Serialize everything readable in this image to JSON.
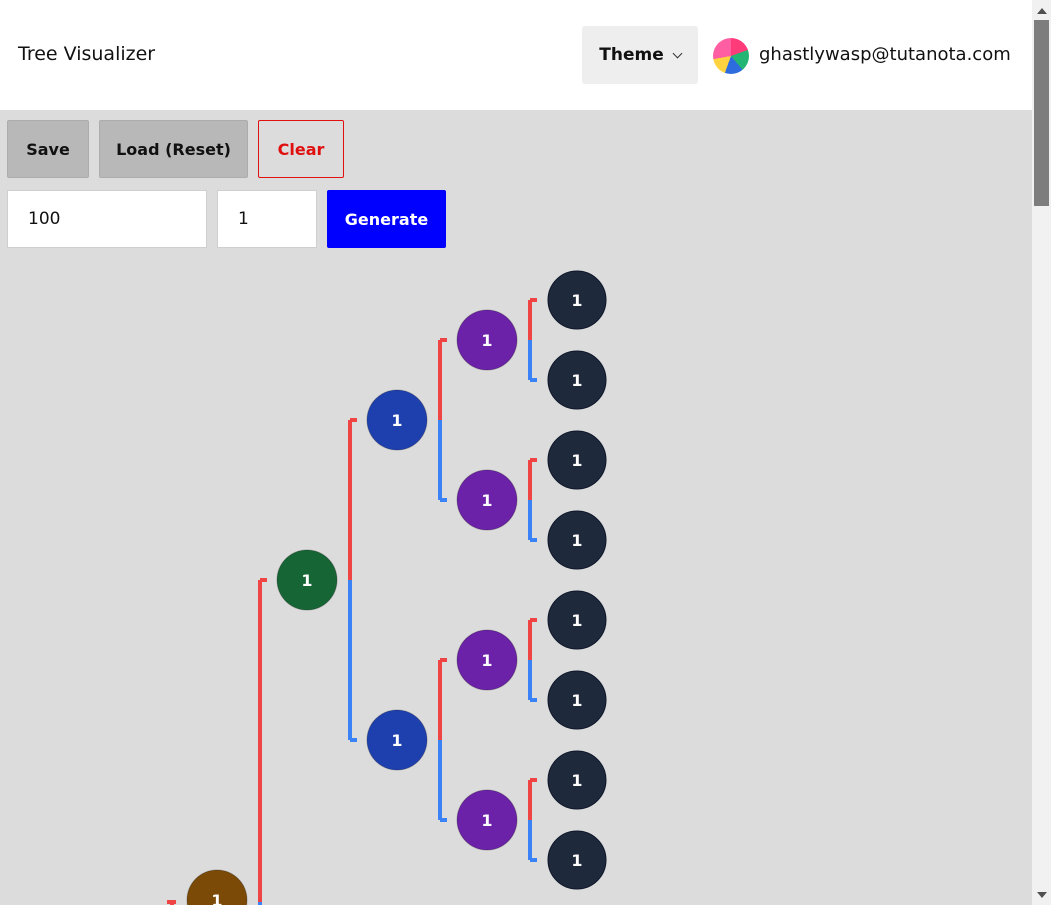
{
  "app": {
    "title": "Tree Visualizer"
  },
  "header": {
    "theme_label": "Theme",
    "user_email": "ghastlywasp@tutanota.com"
  },
  "toolbar": {
    "save_label": "Save",
    "load_label": "Load (Reset)",
    "clear_label": "Clear",
    "generate_label": "Generate"
  },
  "inputs": {
    "count_value": "100",
    "value_value": "1"
  },
  "tree": {
    "node_value": "1",
    "colors": {
      "level0": "#7a4a06",
      "level1": "#166534",
      "level2": "#1e40af",
      "level3": "#6b21a8",
      "level4": "#1e293b",
      "left_edge": "#ef4444",
      "right_edge": "#3b82f6"
    },
    "nodes": [
      {
        "id": "n0",
        "level": 0,
        "value": "1"
      },
      {
        "id": "n1",
        "level": 1,
        "value": "1"
      },
      {
        "id": "n2a",
        "level": 2,
        "value": "1"
      },
      {
        "id": "n2b",
        "level": 2,
        "value": "1"
      },
      {
        "id": "n3a",
        "level": 3,
        "value": "1"
      },
      {
        "id": "n3b",
        "level": 3,
        "value": "1"
      },
      {
        "id": "n3c",
        "level": 3,
        "value": "1"
      },
      {
        "id": "n3d",
        "level": 3,
        "value": "1"
      },
      {
        "id": "n4a",
        "level": 4,
        "value": "1"
      },
      {
        "id": "n4b",
        "level": 4,
        "value": "1"
      },
      {
        "id": "n4c",
        "level": 4,
        "value": "1"
      },
      {
        "id": "n4d",
        "level": 4,
        "value": "1"
      },
      {
        "id": "n4e",
        "level": 4,
        "value": "1"
      },
      {
        "id": "n4f",
        "level": 4,
        "value": "1"
      },
      {
        "id": "n4g",
        "level": 4,
        "value": "1"
      },
      {
        "id": "n4h",
        "level": 4,
        "value": "1"
      }
    ]
  }
}
